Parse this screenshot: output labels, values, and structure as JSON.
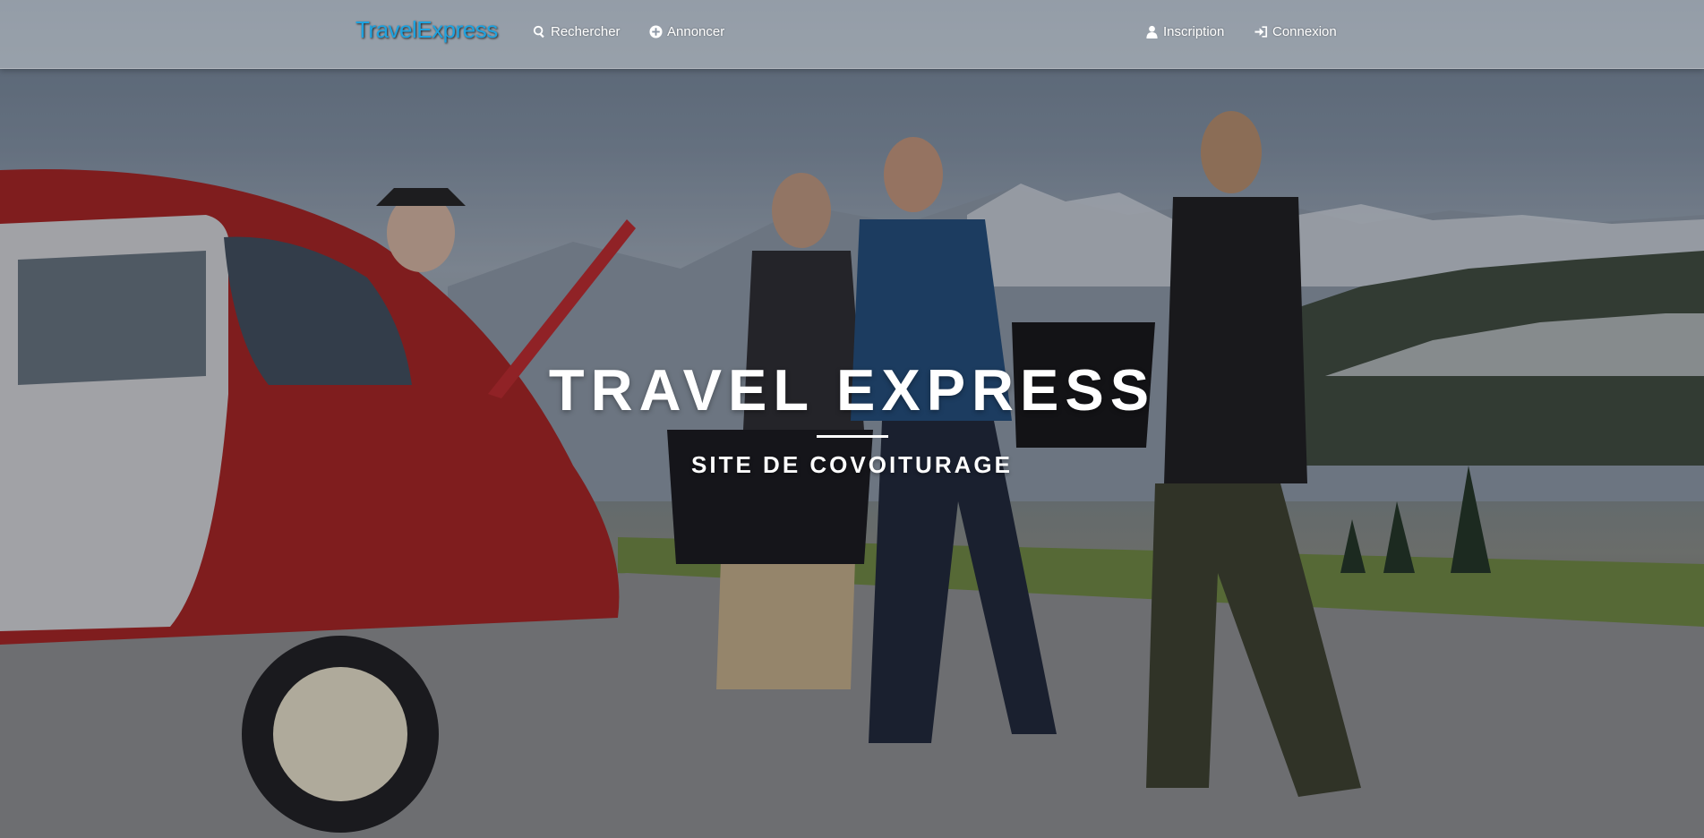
{
  "navbar": {
    "brand": "TravelExpress",
    "links": {
      "search": {
        "label": "Rechercher",
        "icon": "search-icon"
      },
      "announce": {
        "label": "Annoncer",
        "icon": "plus-circle-icon"
      },
      "signup": {
        "label": "Inscription",
        "icon": "user-icon"
      },
      "login": {
        "label": "Connexion",
        "icon": "sign-in-icon"
      }
    }
  },
  "hero": {
    "title": "TRAVEL EXPRESS",
    "subtitle": "SITE DE COVOITURAGE"
  },
  "colors": {
    "brand": "#1ea3e0",
    "nav_text": "#ffffff",
    "hero_text": "#ffffff"
  }
}
